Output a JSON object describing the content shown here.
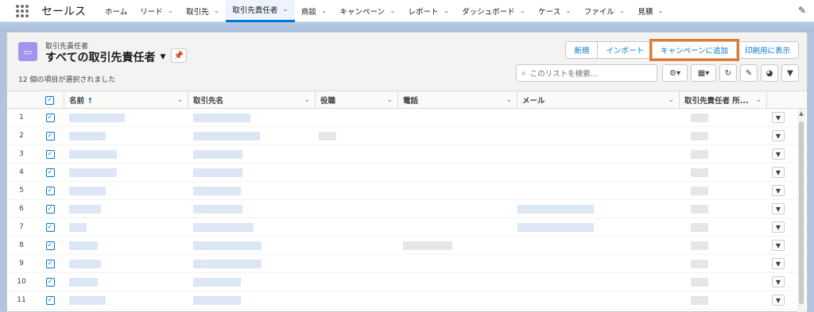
{
  "app": {
    "name": "セールス"
  },
  "nav": {
    "items": [
      {
        "label": "ホーム",
        "chevron": false,
        "active": false
      },
      {
        "label": "リード",
        "chevron": true,
        "active": false
      },
      {
        "label": "取引先",
        "chevron": true,
        "active": false
      },
      {
        "label": "取引先責任者",
        "chevron": true,
        "active": true
      },
      {
        "label": "商談",
        "chevron": true,
        "active": false
      },
      {
        "label": "キャンペーン",
        "chevron": true,
        "active": false
      },
      {
        "label": "レポート",
        "chevron": true,
        "active": false
      },
      {
        "label": "ダッシュボード",
        "chevron": true,
        "active": false
      },
      {
        "label": "ケース",
        "chevron": true,
        "active": false
      },
      {
        "label": "ファイル",
        "chevron": true,
        "active": false
      },
      {
        "label": "見積",
        "chevron": true,
        "active": false
      }
    ],
    "edit_icon": "pencil-icon"
  },
  "list": {
    "object_type": "取引先責任者",
    "title": "すべての取引先責任者",
    "selected_text": "12 個の項目が選択されました",
    "search_placeholder": "このリストを検索..."
  },
  "actions": {
    "new": "新規",
    "import": "インポート",
    "add_to_campaign": "キャンペーンに追加",
    "printable_view": "印刷用に表示"
  },
  "table": {
    "columns": [
      "名前",
      "取引先名",
      "役職",
      "電話",
      "メール",
      "取引先責任者 所..."
    ],
    "sort_indicator": "↑",
    "row_numbers": [
      "1",
      "2",
      "3",
      "4",
      "5",
      "6",
      "7",
      "8",
      "9",
      "10",
      "11"
    ]
  },
  "colors": {
    "accent": "#0176d3",
    "highlight_outline": "#e7792b",
    "object_icon": "#a094ed"
  }
}
